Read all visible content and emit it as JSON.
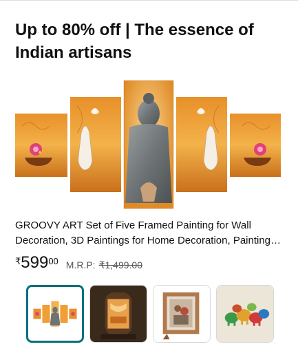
{
  "card": {
    "title": "Up to 80% off | The essence of Indian artisans"
  },
  "product": {
    "name": "GROOVY ART Set of Five Framed Painting for Wall Decoration, 3D Paintings for Home Decoration, Painting for Living Room",
    "price": {
      "currency": "₹",
      "whole": "599",
      "fraction": "00"
    },
    "mrp_label": "M.R.P:",
    "mrp_value": "₹1,499.00"
  },
  "thumbnails": {
    "selected_index": 0,
    "items": [
      {
        "subject": "buddha-wall-painting-set",
        "selected": true
      },
      {
        "subject": "decorative-lamp"
      },
      {
        "subject": "wooden-photo-frame"
      },
      {
        "subject": "colorful-elephant-figurines"
      }
    ]
  },
  "colors": {
    "selected_border": "#00707a",
    "text": "#0f1111",
    "muted_text": "#565959",
    "thumb_border": "#d5d9d9"
  }
}
